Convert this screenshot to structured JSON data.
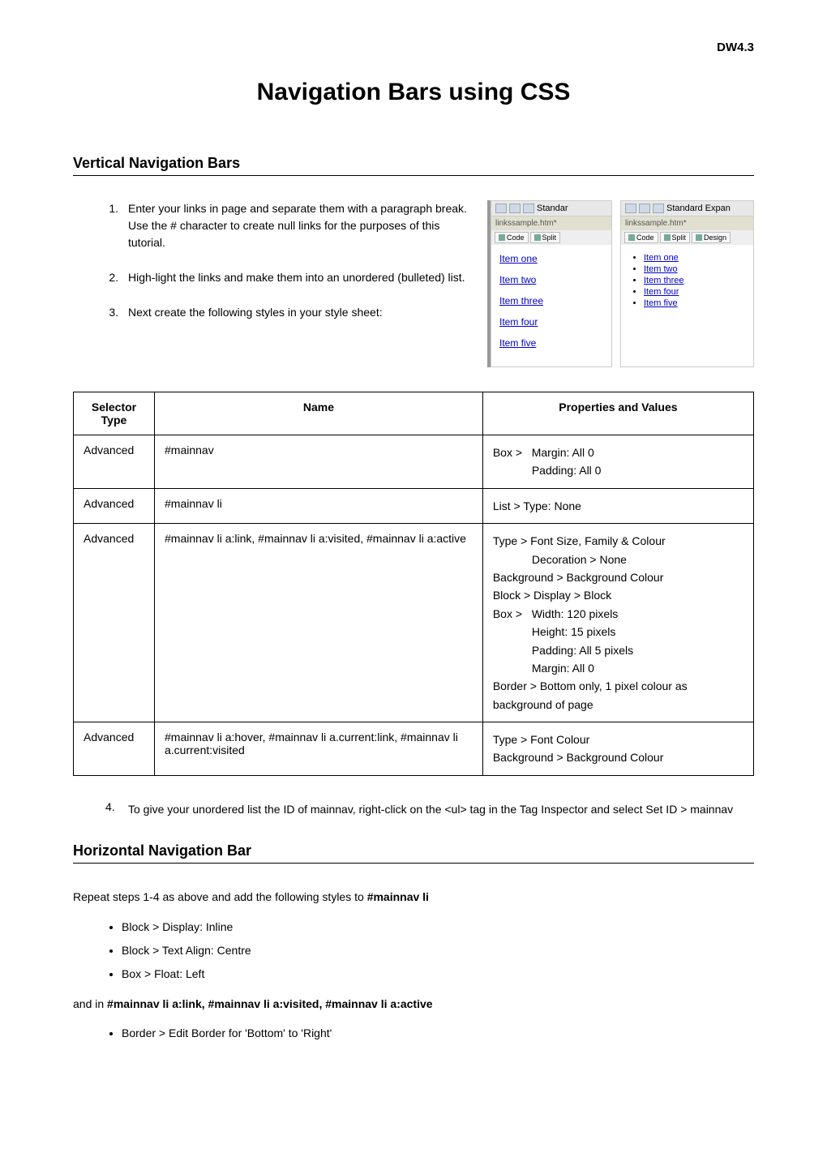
{
  "header_code": "DW4.3",
  "title": "Navigation Bars using CSS",
  "section1": {
    "heading": "Vertical Navigation Bars",
    "steps": [
      "Enter your links in page and separate them with a paragraph break. Use the # character to create null links for the purposes of this tutorial.",
      "High-light the links and make them into an unordered (bulleted) list.",
      "Next create the following styles in your style sheet:"
    ],
    "step4_num": "4.",
    "step4": "To give your unordered list the ID of mainnav, right-click on the <ul> tag in the Tag Inspector and select Set ID > mainnav"
  },
  "screenshot": {
    "toolbar_label_1": "Standar",
    "toolbar_label_2": "Standard",
    "toolbar_label_3": "Expan",
    "tab": "linkssample.htm*",
    "btn_code": "Code",
    "btn_split": "Split",
    "btn_design": "Design",
    "items": [
      "Item one",
      "Item two",
      "Item three",
      "Item four",
      "Item five"
    ]
  },
  "table": {
    "headers": {
      "selector_type": "Selector Type",
      "name": "Name",
      "props": "Properties and Values"
    },
    "rows": [
      {
        "type": "Advanced",
        "name": "#mainnav",
        "props_lines": [
          "Box >   Margin: All 0",
          "            Padding: All 0"
        ]
      },
      {
        "type": "Advanced",
        "name": "#mainnav li",
        "props_lines": [
          "List > Type: None"
        ]
      },
      {
        "type": "Advanced",
        "name": "#mainnav li a:link, #mainnav li a:visited, #mainnav li a:active",
        "props_lines": [
          "Type > Font Size, Family & Colour",
          "            Decoration > None",
          "Background > Background Colour",
          "Block > Display > Block",
          "Box >   Width: 120 pixels",
          "            Height: 15 pixels",
          "            Padding: All 5 pixels",
          "            Margin: All 0",
          "Border > Bottom only, 1 pixel colour as background of page"
        ]
      },
      {
        "type": "Advanced",
        "name": "#mainnav li a:hover, #mainnav li a.current:link, #mainnav li a.current:visited",
        "props_lines": [
          "Type > Font Colour",
          "Background > Background Colour"
        ]
      }
    ]
  },
  "section2": {
    "heading": "Horizontal Navigation Bar",
    "intro_pre": "Repeat steps 1-4 as above and add the following styles to ",
    "intro_bold": "#mainnav li",
    "bullets1": [
      "Block > Display: Inline",
      "Block > Text Align: Centre",
      "Box > Float: Left"
    ],
    "and_in_pre": "and in ",
    "and_in_bold": "#mainnav li a:link, #mainnav li a:visited, #mainnav li a:active",
    "bullets2": [
      "Border > Edit Border for 'Bottom' to 'Right'"
    ]
  }
}
